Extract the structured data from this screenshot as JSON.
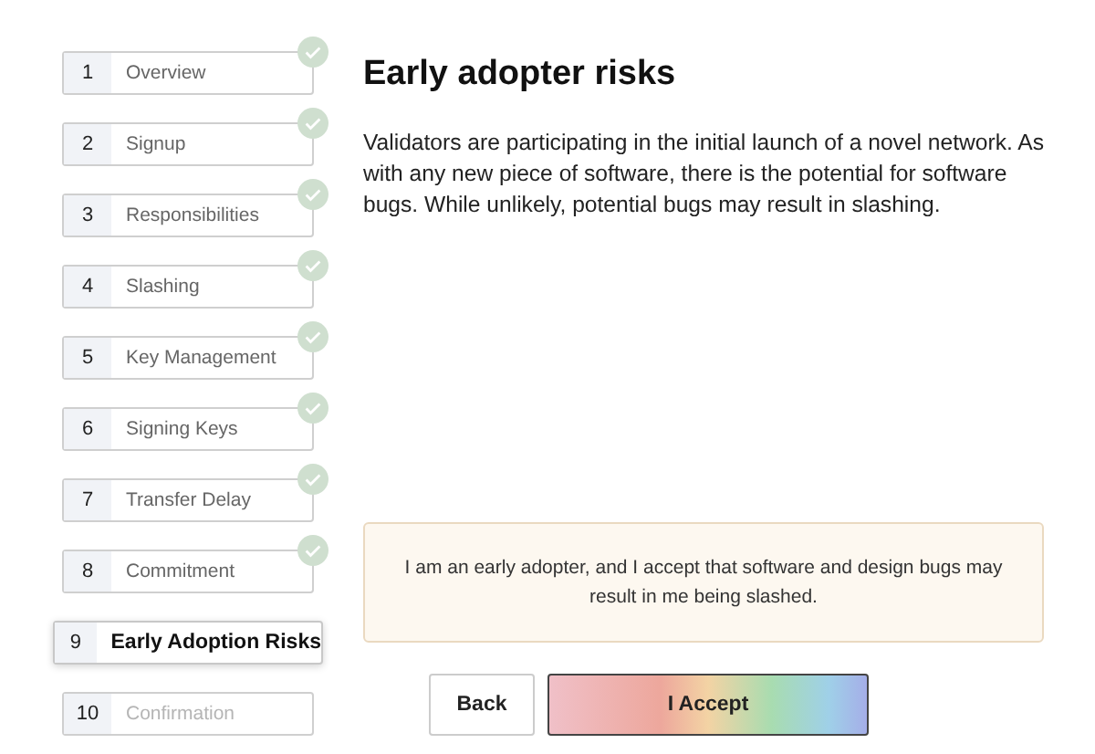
{
  "steps": [
    {
      "number": "1",
      "label": "Overview",
      "completed": true,
      "selected": false
    },
    {
      "number": "2",
      "label": "Signup",
      "completed": true,
      "selected": false
    },
    {
      "number": "3",
      "label": "Responsibilities",
      "completed": true,
      "selected": false
    },
    {
      "number": "4",
      "label": "Slashing",
      "completed": true,
      "selected": false
    },
    {
      "number": "5",
      "label": "Key Management",
      "completed": true,
      "selected": false
    },
    {
      "number": "6",
      "label": "Signing Keys",
      "completed": true,
      "selected": false
    },
    {
      "number": "7",
      "label": "Transfer Delay",
      "completed": true,
      "selected": false
    },
    {
      "number": "8",
      "label": "Commitment",
      "completed": true,
      "selected": false
    },
    {
      "number": "9",
      "label": "Early Adoption Risks",
      "completed": false,
      "selected": true
    },
    {
      "number": "10",
      "label": "Confirmation",
      "completed": false,
      "selected": false
    }
  ],
  "heading": "Early adopter risks",
  "description": "Validators are participating in the initial launch of a novel network. As with any new piece of software, there is the potential for software bugs. While unlikely, potential bugs may result in slashing.",
  "agreement": "I am an early adopter, and I accept that software and design bugs may result in me being slashed.",
  "buttons": [
    {
      "kind": "secondary",
      "label": "Back"
    },
    {
      "kind": "primary",
      "label": "I Accept"
    }
  ]
}
